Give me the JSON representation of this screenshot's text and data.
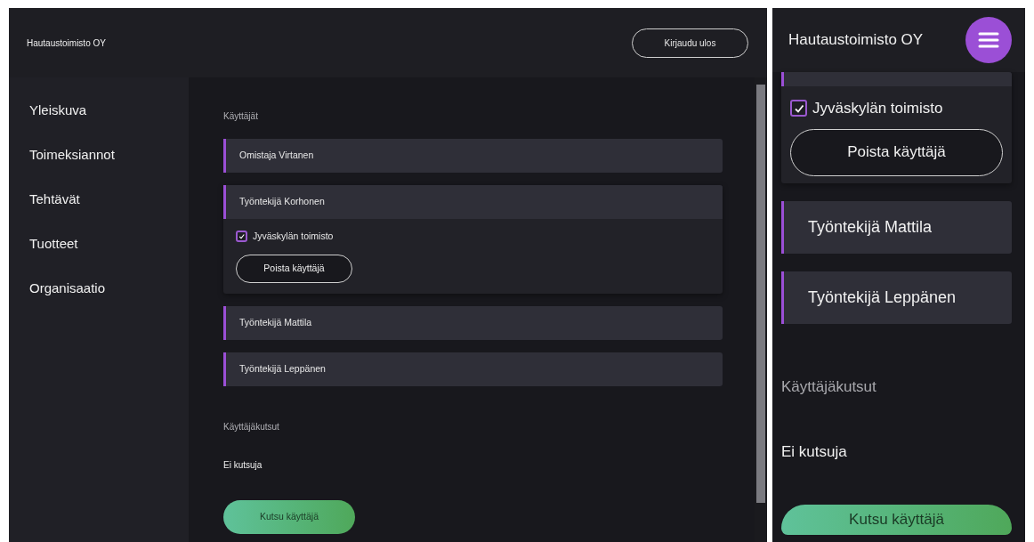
{
  "desktop": {
    "header": {
      "title": "Hautaustoimisto OY",
      "logout_button": "Kirjaudu ulos"
    },
    "sidebar": {
      "items": [
        "Yleiskuva",
        "Toimeksiannot",
        "Tehtävät",
        "Tuotteet",
        "Organisaatio"
      ]
    },
    "users_heading": "Käyttäjät",
    "users": [
      {
        "name": "Omistaja Virtanen",
        "expanded": false
      },
      {
        "name": "Työntekijä Korhonen",
        "expanded": true,
        "office": {
          "label": "Jyväskylän toimisto",
          "checked": true
        },
        "remove_button": "Poista käyttäjä"
      },
      {
        "name": "Työntekijä Mattila",
        "expanded": false
      },
      {
        "name": "Työntekijä Leppänen",
        "expanded": false
      }
    ],
    "invites_heading": "Käyttäjäkutsut",
    "invites_empty": "Ei kutsuja",
    "invite_button": "Kutsu käyttäjä"
  },
  "mobile": {
    "header": {
      "title": "Hautaustoimisto OY"
    },
    "users": [
      {
        "expanded": true,
        "office": {
          "label": "Jyväskylän toimisto",
          "checked": true
        },
        "remove_button": "Poista käyttäjä"
      },
      {
        "name": "Työntekijä Mattila",
        "expanded": false
      },
      {
        "name": "Työntekijä Leppänen",
        "expanded": false
      }
    ],
    "invites_heading": "Käyttäjäkutsut",
    "invites_empty": "Ei kutsuja",
    "invite_button": "Kutsu käyttäjä"
  }
}
